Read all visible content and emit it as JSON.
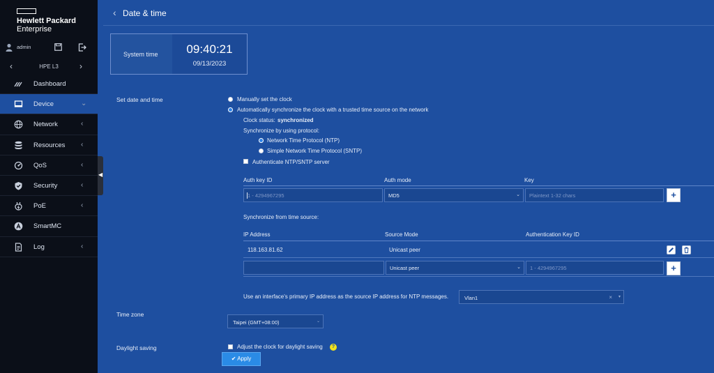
{
  "brand": {
    "line1": "Hewlett Packard",
    "line2": "Enterprise"
  },
  "user": {
    "name": "admin"
  },
  "switch": {
    "name": "HPE L3"
  },
  "nav": [
    {
      "label": "Dashboard",
      "icon": "dashboard-icon",
      "arrow": ""
    },
    {
      "label": "Device",
      "icon": "device-icon",
      "arrow": "⌄"
    },
    {
      "label": "Network",
      "icon": "globe-icon",
      "arrow": "‹"
    },
    {
      "label": "Resources",
      "icon": "database-icon",
      "arrow": "‹"
    },
    {
      "label": "QoS",
      "icon": "qos-icon",
      "arrow": "‹"
    },
    {
      "label": "Security",
      "icon": "shield-icon",
      "arrow": "‹"
    },
    {
      "label": "PoE",
      "icon": "poe-icon",
      "arrow": "‹"
    },
    {
      "label": "SmartMC",
      "icon": "smartmc-icon",
      "arrow": ""
    },
    {
      "label": "Log",
      "icon": "log-icon",
      "arrow": "‹"
    }
  ],
  "page": {
    "title": "Date & time"
  },
  "system_time": {
    "label": "System time",
    "time": "09:40:21",
    "date": "09/13/2023"
  },
  "set_date": {
    "label": "Set date and time",
    "manual": "Manually set the clock",
    "auto": "Automatically synchronize the clock with a trusted time source on the network",
    "status_label": "Clock status:",
    "status_value": "synchronized",
    "protocol_label": "Synchronize by using protocol:",
    "ntp": "Network Time Protocol (NTP)",
    "sntp": "Simple Network Time Protocol (SNTP)",
    "auth_checkbox": "Authenticate NTP/SNTP server"
  },
  "auth_table": {
    "col_keyid": "Auth key ID",
    "col_mode": "Auth mode",
    "col_key": "Key",
    "keyid_placeholder": "1 - 4294967295",
    "mode_value": "MD5",
    "key_placeholder": "Plaintext 1-32 chars"
  },
  "sources": {
    "label": "Synchronize from time source:",
    "col_ip": "IP Address",
    "col_mode": "Source Mode",
    "col_authkey": "Authentication Key ID",
    "rows": [
      {
        "ip": "118.163.81.62",
        "mode": "Unicast peer"
      }
    ],
    "new_mode": "Unicast peer",
    "new_authkey_placeholder": "1 - 4294967295"
  },
  "interface": {
    "label": "Use an interface's primary IP address as the source IP address for NTP messages.",
    "value": "Vlan1"
  },
  "timezone": {
    "label": "Time zone",
    "value": "Taipei (GMT+08:00)"
  },
  "daylight": {
    "label": "Daylight saving",
    "checkbox": "Adjust the clock for daylight saving"
  },
  "apply": {
    "label": "Apply"
  }
}
